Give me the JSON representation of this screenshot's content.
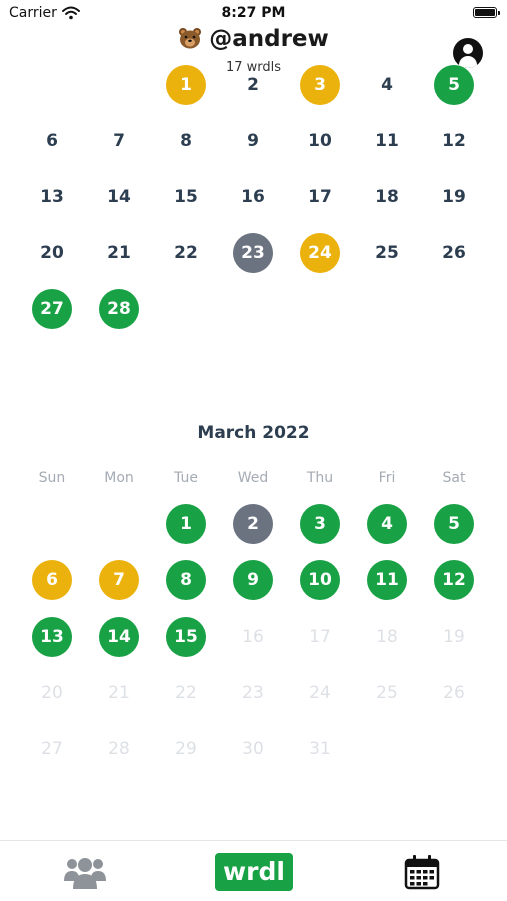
{
  "status_bar": {
    "carrier": "Carrier",
    "time": "8:27 PM"
  },
  "header": {
    "title": "@andrew",
    "subtitle": "17 wrdls",
    "emoji_icon": "bear-face-icon"
  },
  "calendar": {
    "previous_month": {
      "rows": [
        [
          {
            "d": "1",
            "s": "close"
          },
          {
            "d": "2",
            "s": "none"
          },
          {
            "d": "3",
            "s": "close"
          },
          {
            "d": "4",
            "s": "none"
          },
          {
            "d": "5",
            "s": "win"
          }
        ],
        [
          {
            "d": "6",
            "s": "none"
          },
          {
            "d": "7",
            "s": "none"
          },
          {
            "d": "8",
            "s": "none"
          },
          {
            "d": "9",
            "s": "none"
          },
          {
            "d": "10",
            "s": "none"
          },
          {
            "d": "11",
            "s": "none"
          },
          {
            "d": "12",
            "s": "none"
          }
        ],
        [
          {
            "d": "13",
            "s": "none"
          },
          {
            "d": "14",
            "s": "none"
          },
          {
            "d": "15",
            "s": "none"
          },
          {
            "d": "16",
            "s": "none"
          },
          {
            "d": "17",
            "s": "none"
          },
          {
            "d": "18",
            "s": "none"
          },
          {
            "d": "19",
            "s": "none"
          }
        ],
        [
          {
            "d": "20",
            "s": "none"
          },
          {
            "d": "21",
            "s": "none"
          },
          {
            "d": "22",
            "s": "none"
          },
          {
            "d": "23",
            "s": "lose"
          },
          {
            "d": "24",
            "s": "close"
          },
          {
            "d": "25",
            "s": "none"
          },
          {
            "d": "26",
            "s": "none"
          }
        ],
        [
          {
            "d": "27",
            "s": "win"
          },
          {
            "d": "28",
            "s": "win"
          }
        ]
      ]
    },
    "current_month": {
      "title": "March 2022",
      "weekdays": [
        "Sun",
        "Mon",
        "Tue",
        "Wed",
        "Thu",
        "Fri",
        "Sat"
      ],
      "rows": [
        [
          {
            "d": "1",
            "s": "win"
          },
          {
            "d": "2",
            "s": "lose"
          },
          {
            "d": "3",
            "s": "win"
          },
          {
            "d": "4",
            "s": "win"
          },
          {
            "d": "5",
            "s": "win"
          }
        ],
        [
          {
            "d": "6",
            "s": "close"
          },
          {
            "d": "7",
            "s": "close"
          },
          {
            "d": "8",
            "s": "win"
          },
          {
            "d": "9",
            "s": "win"
          },
          {
            "d": "10",
            "s": "win"
          },
          {
            "d": "11",
            "s": "win"
          },
          {
            "d": "12",
            "s": "win"
          }
        ],
        [
          {
            "d": "13",
            "s": "win"
          },
          {
            "d": "14",
            "s": "win"
          },
          {
            "d": "15",
            "s": "win"
          },
          {
            "d": "16",
            "s": "future"
          },
          {
            "d": "17",
            "s": "future"
          },
          {
            "d": "18",
            "s": "future"
          },
          {
            "d": "19",
            "s": "future"
          }
        ],
        [
          {
            "d": "20",
            "s": "future"
          },
          {
            "d": "21",
            "s": "future"
          },
          {
            "d": "22",
            "s": "future"
          },
          {
            "d": "23",
            "s": "future"
          },
          {
            "d": "24",
            "s": "future"
          },
          {
            "d": "25",
            "s": "future"
          },
          {
            "d": "26",
            "s": "future"
          }
        ],
        [
          {
            "d": "27",
            "s": "future"
          },
          {
            "d": "28",
            "s": "future"
          },
          {
            "d": "29",
            "s": "future"
          },
          {
            "d": "30",
            "s": "future"
          },
          {
            "d": "31",
            "s": "future"
          }
        ]
      ]
    }
  },
  "tabbar": {
    "friends_icon": "friends-group-icon",
    "wrdl_label": "wrdl",
    "calendar_icon": "calendar-icon"
  },
  "colors": {
    "win": "#18a145",
    "close": "#ebb10c",
    "lose": "#6b7280",
    "future": "#dde1e6"
  }
}
